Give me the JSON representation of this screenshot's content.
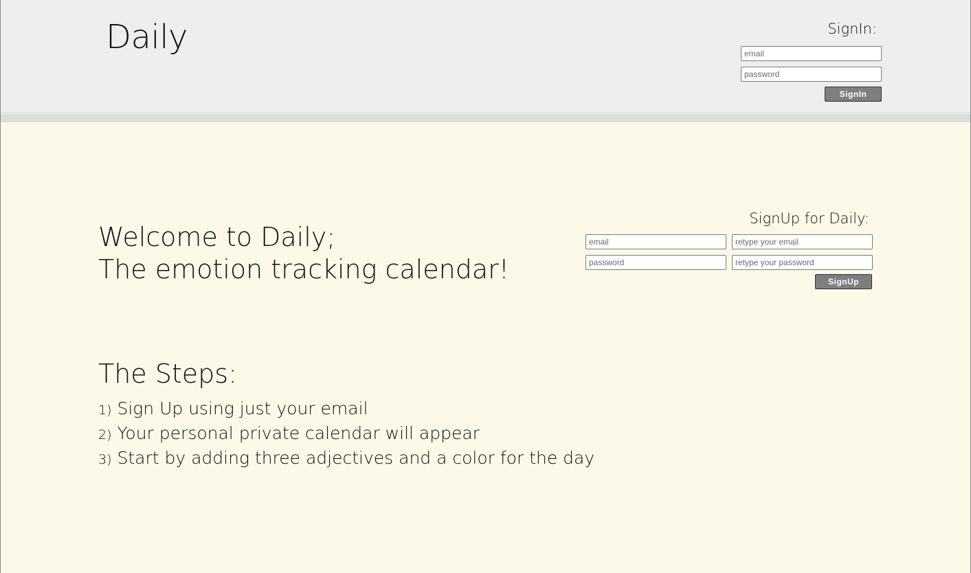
{
  "header": {
    "brand": "Daily",
    "signin": {
      "title": "SignIn:",
      "email_placeholder": "email",
      "password_placeholder": "password",
      "button_label": "SignIn"
    }
  },
  "main": {
    "welcome_line1": "Welcome to Daily;",
    "welcome_line2": "The emotion tracking calendar!",
    "signup": {
      "title": "SignUp for Daily:",
      "email_placeholder": "email",
      "retype_email_placeholder": "retype your email",
      "password_placeholder": "password",
      "retype_password_placeholder": "retype your password",
      "button_label": "SignUp"
    },
    "steps_title": "The Steps:",
    "steps": [
      {
        "num": "1)",
        "text": "Sign Up using just your email"
      },
      {
        "num": "2)",
        "text": "Your personal private calendar will appear"
      },
      {
        "num": "3)",
        "text": "Start by adding three adjectives and a color for the day"
      }
    ]
  },
  "colors": {
    "page_bg": "#fcf9e8",
    "header_bg": "#eeeeee",
    "button_bg": "#7e7e7e"
  }
}
